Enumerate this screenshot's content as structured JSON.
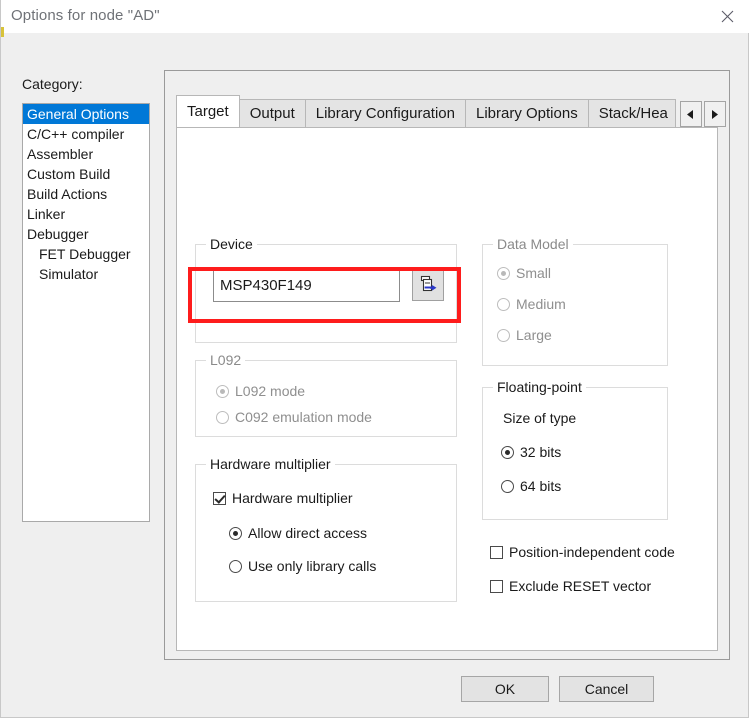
{
  "window": {
    "title": "Options for node \"AD\"",
    "close_icon": "close-icon"
  },
  "category": {
    "label": "Category:",
    "items": [
      {
        "label": "General Options",
        "selected": true,
        "indent": false
      },
      {
        "label": "C/C++ compiler",
        "selected": false,
        "indent": false
      },
      {
        "label": "Assembler",
        "selected": false,
        "indent": false
      },
      {
        "label": "Custom Build",
        "selected": false,
        "indent": false
      },
      {
        "label": "Build Actions",
        "selected": false,
        "indent": false
      },
      {
        "label": "Linker",
        "selected": false,
        "indent": false
      },
      {
        "label": "Debugger",
        "selected": false,
        "indent": false
      },
      {
        "label": "FET Debugger",
        "selected": false,
        "indent": true
      },
      {
        "label": "Simulator",
        "selected": false,
        "indent": true
      }
    ]
  },
  "tabs": {
    "items": [
      {
        "label": "Target",
        "active": true
      },
      {
        "label": "Output",
        "active": false
      },
      {
        "label": "Library Configuration",
        "active": false
      },
      {
        "label": "Library Options",
        "active": false
      },
      {
        "label": "Stack/Hea",
        "active": false,
        "clipped": true
      }
    ],
    "scroll_left_icon": "chevron-left-icon",
    "scroll_right_icon": "chevron-right-icon"
  },
  "device": {
    "group_title": "Device",
    "value": "MSP430F149",
    "picker_icon": "device-select-icon"
  },
  "l092": {
    "group_title": "L092",
    "disabled": true,
    "options": [
      {
        "label": "L092 mode",
        "selected": true
      },
      {
        "label": "C092 emulation mode",
        "selected": false
      }
    ]
  },
  "hardware_multiplier": {
    "group_title": "Hardware multiplier",
    "enable_label": "Hardware multiplier",
    "enabled": true,
    "options": [
      {
        "label": "Allow direct access",
        "selected": true
      },
      {
        "label": "Use only library calls",
        "selected": false
      }
    ]
  },
  "data_model": {
    "group_title": "Data Model",
    "disabled": true,
    "options": [
      {
        "label": "Small",
        "selected": true
      },
      {
        "label": "Medium",
        "selected": false
      },
      {
        "label": "Large",
        "selected": false
      }
    ]
  },
  "floating_point": {
    "group_title": "Floating-point",
    "size_label": "Size of type",
    "options": [
      {
        "label": "32 bits",
        "selected": true
      },
      {
        "label": "64 bits",
        "selected": false
      }
    ]
  },
  "extra_checkboxes": [
    {
      "label": "Position-independent code",
      "checked": false
    },
    {
      "label": "Exclude RESET vector",
      "checked": false
    }
  ],
  "footer": {
    "ok_label": "OK",
    "cancel_label": "Cancel"
  },
  "colors": {
    "selection_blue": "#0078d7",
    "annotation_red": "#fe1c1c",
    "title_text": "#6f7277"
  }
}
